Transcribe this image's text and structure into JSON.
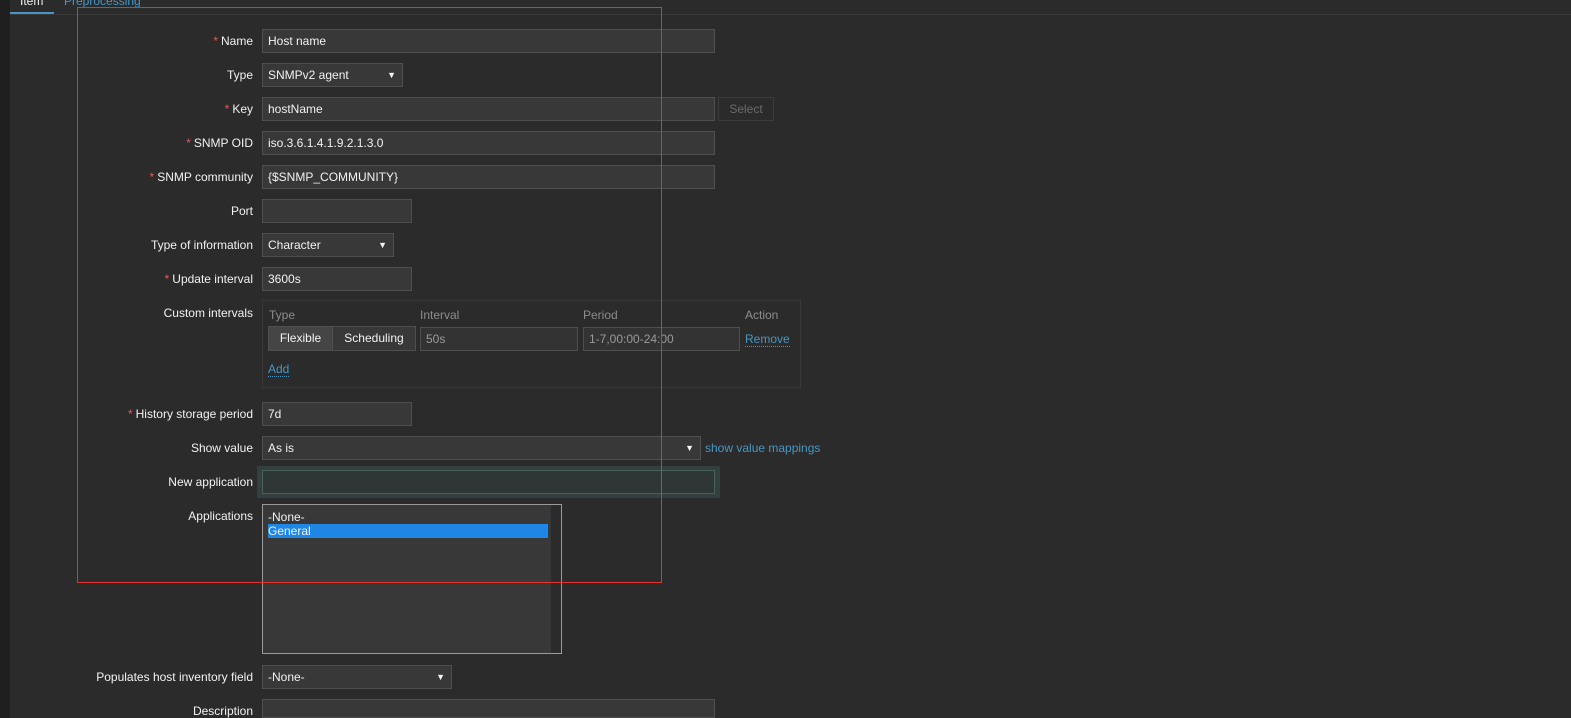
{
  "tabs": [
    "Item",
    "Preprocessing"
  ],
  "form": {
    "name": {
      "label": "Name",
      "value": "Host name",
      "required": true
    },
    "type": {
      "label": "Type",
      "value": "SNMPv2 agent"
    },
    "key": {
      "label": "Key",
      "value": "hostName",
      "required": true,
      "select_label": "Select"
    },
    "snmp_oid": {
      "label": "SNMP OID",
      "value": "iso.3.6.1.4.1.9.2.1.3.0",
      "required": true
    },
    "snmp_community": {
      "label": "SNMP community",
      "value": "{$SNMP_COMMUNITY}",
      "required": true
    },
    "port": {
      "label": "Port",
      "value": ""
    },
    "type_of_information": {
      "label": "Type of information",
      "value": "Character"
    },
    "update_interval": {
      "label": "Update interval",
      "value": "3600s",
      "required": true
    },
    "custom_intervals": {
      "label": "Custom intervals",
      "columns": [
        "Type",
        "Interval",
        "Period",
        "Action"
      ],
      "row": {
        "type_options": [
          "Flexible",
          "Scheduling"
        ],
        "selected_type": "Flexible",
        "interval": "50s",
        "period": "1-7,00:00-24:00",
        "action": "Remove"
      },
      "add_label": "Add"
    },
    "history_storage_period": {
      "label": "History storage period",
      "value": "7d",
      "required": true
    },
    "show_value": {
      "label": "Show value",
      "value": "As is",
      "link": "show value mappings"
    },
    "new_application": {
      "label": "New application",
      "value": ""
    },
    "applications": {
      "label": "Applications",
      "options": [
        "-None-",
        "General"
      ],
      "selected": "General"
    },
    "populates_host_inventory_field": {
      "label": "Populates host inventory field",
      "value": "-None-"
    },
    "description": {
      "label": "Description",
      "value": ""
    }
  },
  "required_marker": "*",
  "caret": "▼",
  "colors": {
    "background": "#2b2b2b",
    "input_bg": "#383838",
    "accent": "#4796c4",
    "required": "#e45959",
    "highlight_box": "#e5322d",
    "selection": "#1e87e5"
  }
}
